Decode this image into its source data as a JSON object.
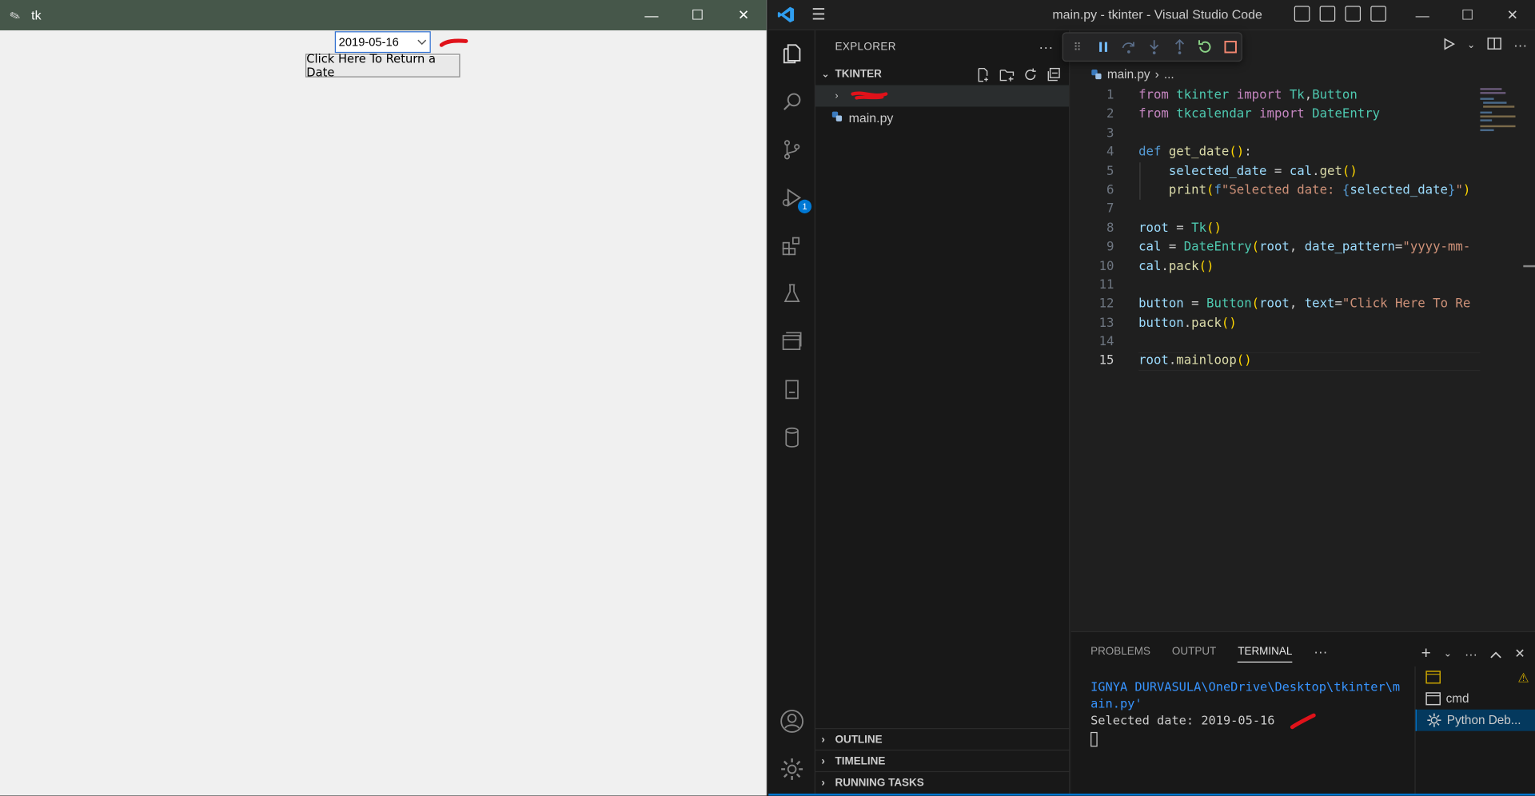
{
  "tk_window": {
    "title": "tk",
    "date_value": "2019-05-16",
    "button_label": "Click Here To Return a Date"
  },
  "vscode": {
    "window_title": "main.py - tkinter - Visual Studio Code",
    "explorer_label": "EXPLORER",
    "folder_name": "TKINTER",
    "files": [
      "main.py"
    ],
    "breadcrumb_file": "main.py",
    "breadcrumb_rest": "...",
    "run_badge": "1",
    "outline_label": "OUTLINE",
    "timeline_label": "TIMELINE",
    "running_tasks_label": "RUNNING TASKS",
    "code_lines": [
      "1",
      "2",
      "3",
      "4",
      "5",
      "6",
      "7",
      "8",
      "9",
      "10",
      "11",
      "12",
      "13",
      "14",
      "15"
    ],
    "panel_tabs": [
      "PROBLEMS",
      "OUTPUT",
      "TERMINAL"
    ],
    "terminal": {
      "path_line1": "IGNYA DURVASULA\\OneDrive\\Desktop\\tkinter\\m",
      "path_line2": "ain.py'",
      "output": "Selected date: 2019-05-16"
    },
    "terminals": [
      "cmd",
      "Python Deb..."
    ]
  },
  "colors": {
    "accent": "#0078d4",
    "tk_titlebar": "#46574a",
    "annotation_red": "#e0121a"
  }
}
